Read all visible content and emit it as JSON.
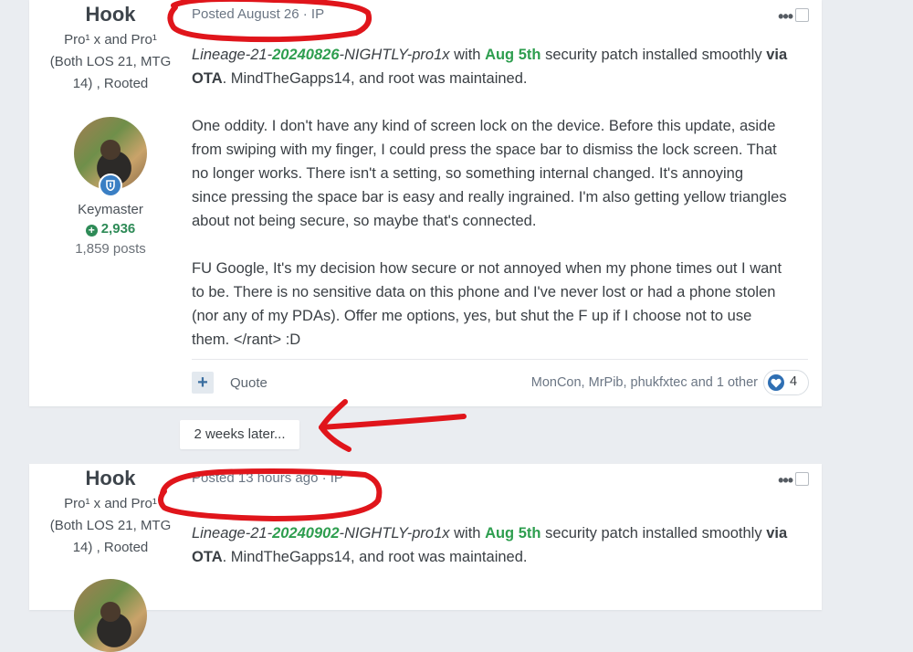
{
  "posts": [
    {
      "author": {
        "name": "Hook",
        "title_line1": "Pro¹ x and Pro¹",
        "title_line2": "(Both LOS 21, MTG",
        "title_line3": "14) , Rooted",
        "role": "Keymaster",
        "reputation": "2,936",
        "post_count": "1,859 posts"
      },
      "meta": "Posted August 26 · IP",
      "options_icon": "more-dots-icon",
      "content": {
        "p1": {
          "build_prefix": "Lineage-21-",
          "build_date": "20240826",
          "build_suffix": "-NIGHTLY-pro1x",
          "text_with": " with ",
          "patch": "Aug 5th",
          "text_mid": " security patch installed smoothly ",
          "via": "via",
          "ota": "OTA",
          "text_end": ". MindTheGapps14, and root was maintained."
        },
        "p2_lines": [
          "One oddity.  I don't have any kind of screen lock on the device. Before this update, aside",
          "from swiping with my finger, I could press the space bar to dismiss the lock screen.  That",
          "no longer works.  There isn't a setting, so something internal changed.  It's annoying",
          "since pressing the space bar is easy and really ingrained.  I'm also getting yellow triangles",
          "about not being secure, so maybe that's connected."
        ],
        "p3_lines": [
          "FU Google, It's my decision how secure or not annoyed when my  phone times out I want",
          "to be.  There is no sensitive data on this phone and I've never lost or had a phone stolen",
          "(nor any of my PDAs).   Offer me options, yes, but shut the F up if I choose not to use",
          "them. </rant>  :D"
        ]
      },
      "footer": {
        "quote_label": "Quote",
        "reactors": "MonCon, MrPib, phukfxtec and 1 other",
        "reaction_count": "4"
      }
    },
    {
      "author": {
        "name": "Hook",
        "title_line1": "Pro¹ x and Pro¹",
        "title_line2": "(Both LOS 21, MTG",
        "title_line3": "14) , Rooted"
      },
      "meta": "Posted 13 hours ago · IP",
      "content": {
        "p1": {
          "build_prefix": "Lineage-21-",
          "build_date": "20240902",
          "build_suffix": "-NIGHTLY-pro1x",
          "text_with": " with ",
          "patch": "Aug 5th",
          "text_mid": " security patch installed smoothly ",
          "via": "via",
          "ota": "OTA",
          "text_end": ". MindTheGapps14, and root was maintained."
        }
      }
    }
  ],
  "gap_label": "2 weeks later...",
  "colors": {
    "page_bg": "#eaedf1",
    "accent_green": "#2e9e4f",
    "annotation_red": "#e0151b",
    "reaction_blue": "#2f6fb3"
  }
}
